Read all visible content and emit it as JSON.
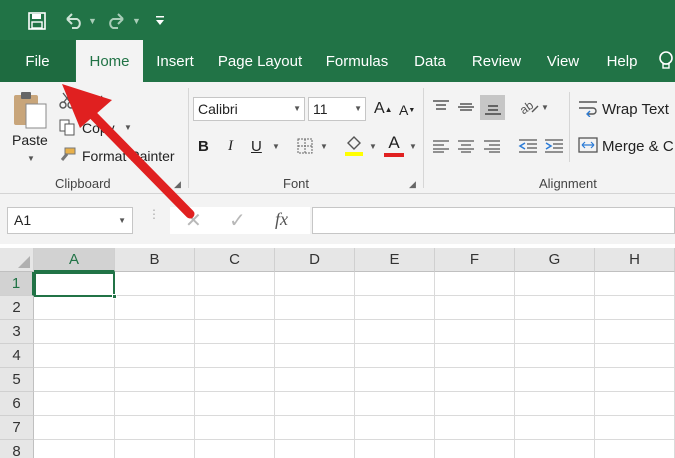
{
  "colors": {
    "excel_green": "#217346",
    "arrow_red": "#e02020"
  },
  "qat": {
    "save_icon": "save-icon",
    "undo_icon": "undo-icon",
    "redo_icon": "redo-icon"
  },
  "tabs": [
    {
      "label": "File"
    },
    {
      "label": "Home"
    },
    {
      "label": "Insert"
    },
    {
      "label": "Page Layout"
    },
    {
      "label": "Formulas"
    },
    {
      "label": "Data"
    },
    {
      "label": "Review"
    },
    {
      "label": "View"
    },
    {
      "label": "Help"
    }
  ],
  "ribbon": {
    "clipboard": {
      "paste": "Paste",
      "cut": "Cut",
      "copy": "Copy",
      "format_painter": "Format Painter",
      "label": "Clipboard"
    },
    "font": {
      "name": "Calibri",
      "size": "11",
      "bold": "B",
      "italic": "I",
      "underline": "U",
      "font_color": "A",
      "label": "Font"
    },
    "alignment": {
      "wrap": "Wrap Text",
      "merge": "Merge & C",
      "label": "Alignment"
    }
  },
  "formula_bar": {
    "name_box": "A1",
    "fx": "fx"
  },
  "grid": {
    "columns": [
      "A",
      "B",
      "C",
      "D",
      "E",
      "F",
      "G",
      "H"
    ],
    "rows": [
      "1",
      "2",
      "3",
      "4",
      "5",
      "6",
      "7",
      "8"
    ],
    "active_cell": "A1"
  }
}
